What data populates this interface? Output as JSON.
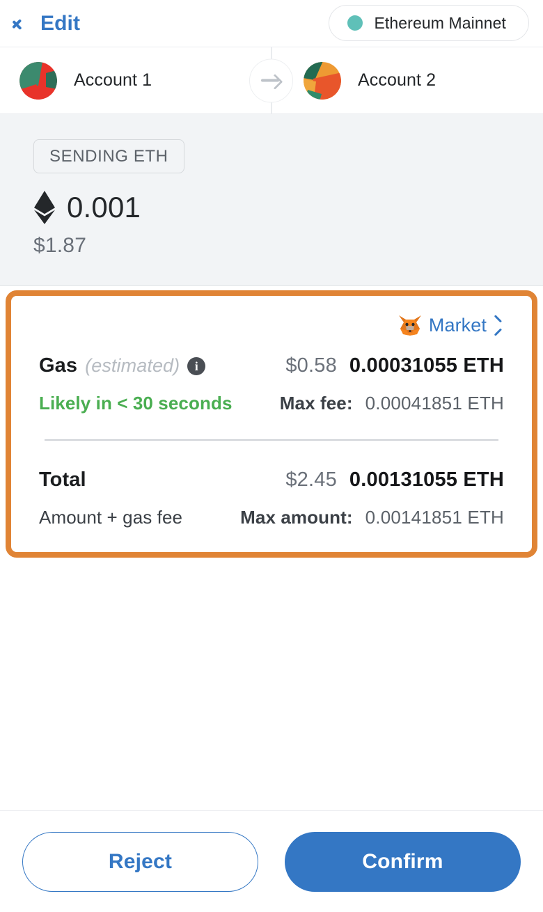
{
  "header": {
    "back_label": "Edit",
    "back_icon": "chevron-left-icon",
    "network_name": "Ethereum Mainnet",
    "network_dot_color": "#5FC0B8"
  },
  "accounts": {
    "from": {
      "name": "Account 1",
      "avatar": "jazzicon-red-green"
    },
    "to": {
      "name": "Account 2",
      "avatar": "jazzicon-orange-teal"
    },
    "transfer_icon": "arrow-right-icon"
  },
  "sending": {
    "badge_label": "SENDING ETH",
    "token_icon": "ethereum-diamond-icon",
    "amount": "0.001",
    "fiat": "$1.87"
  },
  "gas_card": {
    "border_color": "#E08435",
    "market_link": {
      "icon": "metamask-fox-icon",
      "label": "Market",
      "chevron": "chevron-right-icon"
    },
    "gas": {
      "label": "Gas",
      "estimated_note": "(estimated)",
      "info_icon": "info-circle-icon",
      "fiat": "$0.58",
      "eth": "0.00031055 ETH"
    },
    "speed": {
      "text": "Likely in < 30 seconds",
      "color": "#4AAE51"
    },
    "max_fee": {
      "label": "Max fee:",
      "value": "0.00041851 ETH"
    },
    "total": {
      "label": "Total",
      "sub_label": "Amount + gas fee",
      "fiat": "$2.45",
      "eth": "0.00131055 ETH"
    },
    "max_amount": {
      "label": "Max amount:",
      "value": "0.00141851 ETH"
    }
  },
  "footer": {
    "reject_label": "Reject",
    "confirm_label": "Confirm",
    "primary_color": "#3477C4"
  }
}
